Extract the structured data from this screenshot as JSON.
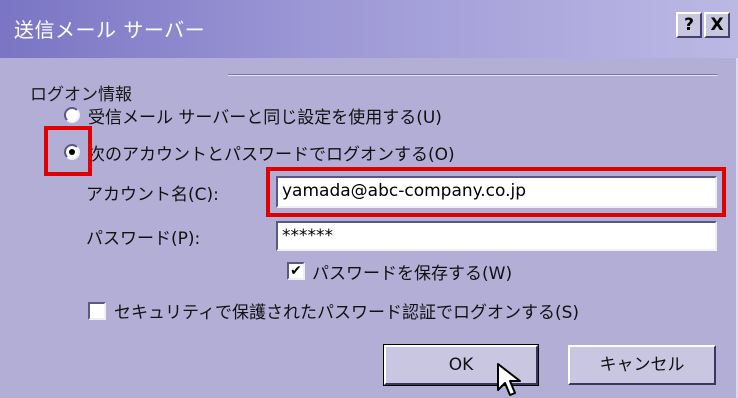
{
  "window": {
    "title": "送信メール サーバー",
    "help_label": "?",
    "close_label": "X"
  },
  "section": {
    "label": "ログオン情報"
  },
  "options": {
    "same_as_incoming": "受信メール サーバーと同じ設定を使用する(U)",
    "logon_with": "次のアカウントとパスワードでログオンする(O)",
    "selected": "logon_with"
  },
  "fields": {
    "account_label": "アカウント名(C):",
    "account_value": "yamada@abc-company.co.jp",
    "password_label": "パスワード(P):",
    "password_value": "******"
  },
  "checkboxes": {
    "save_password": {
      "label": "パスワードを保存する(W)",
      "checked": true,
      "mark": "✔"
    },
    "spa": {
      "label": "セキュリティで保護されたパスワード認証でログオンする(S)",
      "checked": false
    }
  },
  "buttons": {
    "ok": "OK",
    "cancel": "キャンセル"
  },
  "highlight_color": "#e10000"
}
